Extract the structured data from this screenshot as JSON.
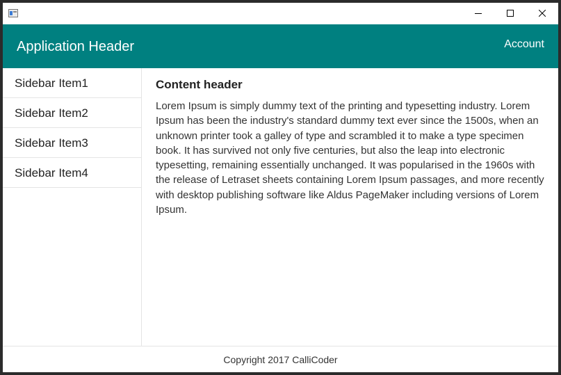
{
  "window": {
    "controls": {
      "minimize_icon": "minimize-icon",
      "maximize_icon": "maximize-icon",
      "close_icon": "close-icon"
    }
  },
  "header": {
    "title": "Application Header",
    "account_label": "Account",
    "background_color": "#008080"
  },
  "sidebar": {
    "items": [
      {
        "label": "Sidebar Item1"
      },
      {
        "label": "Sidebar Item2"
      },
      {
        "label": "Sidebar Item3"
      },
      {
        "label": "Sidebar Item4"
      }
    ]
  },
  "content": {
    "header": "Content header",
    "body": "Lorem Ipsum is simply dummy text of the printing and typesetting industry. Lorem Ipsum has been the industry's standard dummy text ever since the 1500s, when an unknown printer took a galley of type and scrambled it to make a type specimen book. It has survived not only five centuries, but also the leap into electronic typesetting, remaining essentially unchanged. It was popularised in the 1960s with the release of Letraset sheets containing Lorem Ipsum passages, and more recently with desktop publishing software like Aldus PageMaker including versions of Lorem Ipsum."
  },
  "footer": {
    "text": "Copyright 2017 CalliCoder"
  }
}
